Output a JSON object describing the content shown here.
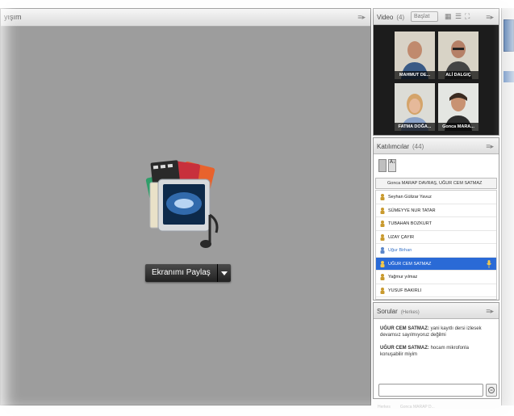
{
  "share_pod": {
    "title": "yışım",
    "share_button_label": "Ekranımı Paylaş"
  },
  "video_pod": {
    "title": "Video",
    "count": "(4)",
    "start_button": "Başlat",
    "participants": [
      {
        "name": "MAHMUT DE..."
      },
      {
        "name": "ALİ DALGIÇ"
      },
      {
        "name": "FATMA DOĞA..."
      },
      {
        "name": "Gonca MARA..."
      }
    ]
  },
  "attendees_pod": {
    "title": "Katılımcılar",
    "count": "(44)",
    "status_line": "Gonca MARAP DAVRAŞ, UĞUR CEM SATMAZ",
    "attendees": [
      {
        "name": "Seyhan Gülizar Yavuz",
        "style": "normal"
      },
      {
        "name": "SÜMEYYE NUR TATAR",
        "style": "normal"
      },
      {
        "name": "TUBAHAN BOZKURT",
        "style": "normal"
      },
      {
        "name": "UZAY ÇAYIR",
        "style": "normal"
      },
      {
        "name": "Uğur Birhan",
        "style": "blue"
      },
      {
        "name": "UĞUR CEM SATMAZ",
        "style": "selected"
      },
      {
        "name": "Yağmur yılmaz",
        "style": "normal"
      },
      {
        "name": "YUSUF BAKIRLI",
        "style": "normal"
      }
    ]
  },
  "questions_pod": {
    "title": "Sorular",
    "subtitle": "(Herkes)",
    "messages": [
      {
        "author": "UĞUR CEM SATMAZ:",
        "text": "yani kayıtlı dersi izlesek devamsız sayılmıyoruz değilmi"
      },
      {
        "author": "UĞUR CEM SATMAZ:",
        "text": "hocam mikrofonla konuşabilir miyim"
      }
    ],
    "tabs": [
      "Herkes",
      "Gonca MARAP D..."
    ]
  },
  "icons": {
    "pod_menu": "menu-icon",
    "share_graphic": "media-share-icon",
    "user": "user-icon",
    "microphone": "microphone-icon",
    "send": "send-icon"
  },
  "colors": {
    "share_bg": "#9d9d9d",
    "selected_row": "#2a6ad6",
    "video_bg": "#1c1c1c"
  }
}
